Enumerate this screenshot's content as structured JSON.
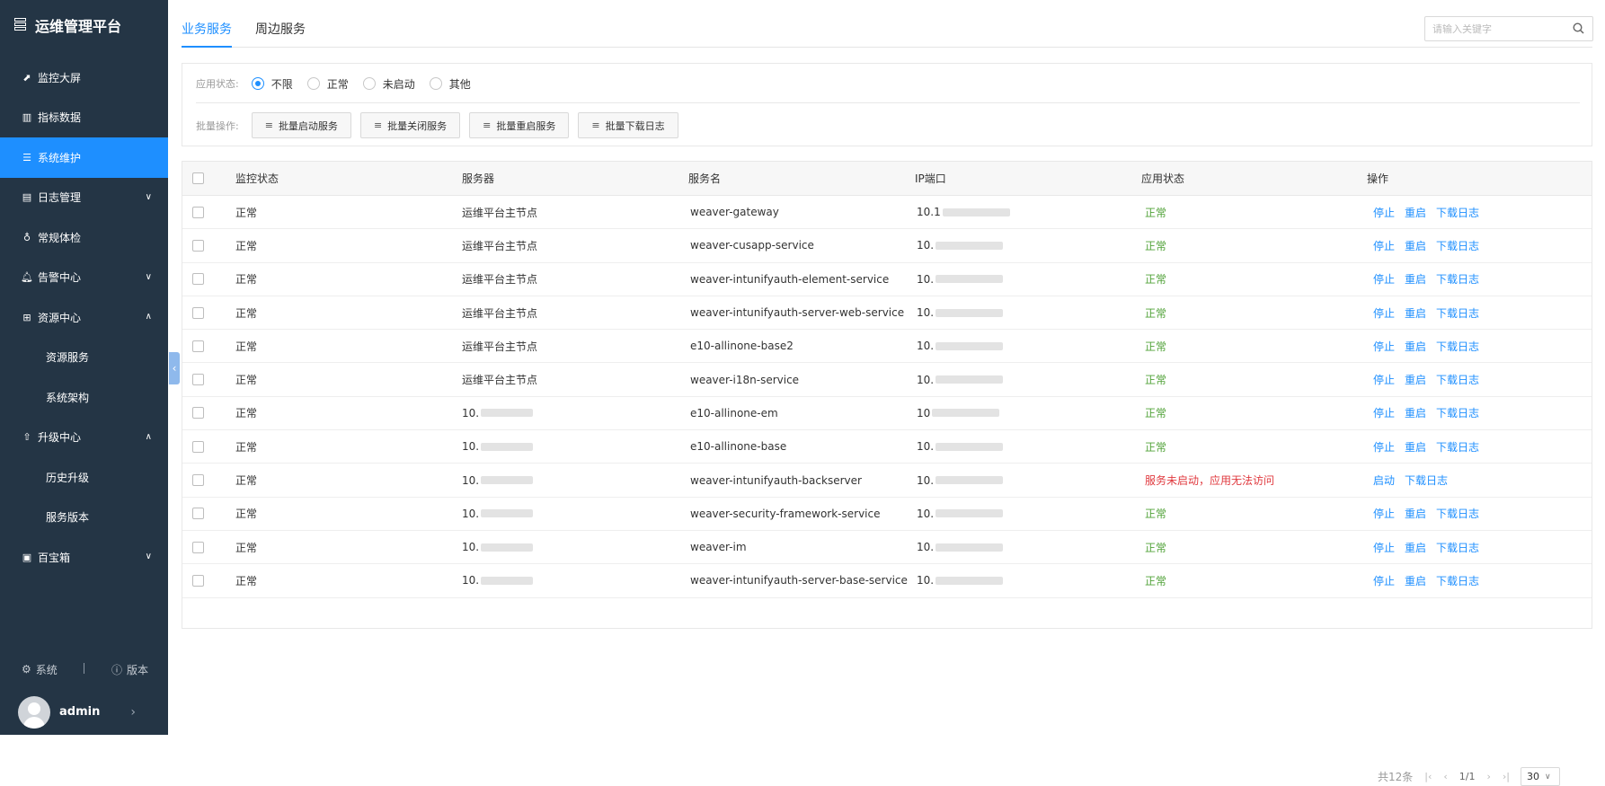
{
  "app": {
    "title": "运维管理平台"
  },
  "sidebar": {
    "items": [
      {
        "label": "监控大屏",
        "icon": "chart-line-icon"
      },
      {
        "label": "指标数据",
        "icon": "bar-chart-icon"
      },
      {
        "label": "系统维护",
        "icon": "sliders-icon",
        "active": true
      },
      {
        "label": "日志管理",
        "icon": "log-icon",
        "chevron": "chevron-down-icon"
      },
      {
        "label": "常规体检",
        "icon": "stethoscope-icon"
      },
      {
        "label": "告警中心",
        "icon": "bell-icon",
        "chevron": "chevron-down-icon"
      },
      {
        "label": "资源中心",
        "icon": "grid-icon",
        "chevron": "chevron-up-icon"
      },
      {
        "label": "资源服务",
        "sub": true
      },
      {
        "label": "系统架构",
        "sub": true
      },
      {
        "label": "升级中心",
        "icon": "upgrade-icon",
        "chevron": "chevron-up-icon"
      },
      {
        "label": "历史升级",
        "sub": true
      },
      {
        "label": "服务版本",
        "sub": true
      },
      {
        "label": "百宝箱",
        "icon": "toolbox-icon",
        "chevron": "chevron-down-icon"
      }
    ],
    "footer": {
      "system_label": "系统",
      "version_label": "版本"
    },
    "user": {
      "name": "admin"
    }
  },
  "tabs": [
    {
      "label": "业务服务",
      "active": true
    },
    {
      "label": "周边服务",
      "active": false
    }
  ],
  "search": {
    "placeholder": "请输入关键字"
  },
  "filters": {
    "status_label": "应用状态:",
    "options": [
      "不限",
      "正常",
      "未启动",
      "其他"
    ],
    "selected": "不限",
    "batch_label": "批量操作:",
    "buttons": [
      "批量启动服务",
      "批量关闭服务",
      "批量重启服务",
      "批量下载日志"
    ]
  },
  "table": {
    "columns": [
      "监控状态",
      "服务器",
      "服务名",
      "IP端口",
      "应用状态",
      "操作"
    ],
    "rows": [
      {
        "monitor": "正常",
        "server": "运维平台主节点",
        "service": "weaver-gateway",
        "ip": "10.1",
        "status": "正常",
        "state": "ok"
      },
      {
        "monitor": "正常",
        "server": "运维平台主节点",
        "service": "weaver-cusapp-service",
        "ip": "10.",
        "status": "正常",
        "state": "ok"
      },
      {
        "monitor": "正常",
        "server": "运维平台主节点",
        "service": "weaver-intunifyauth-element-service",
        "ip": "10.",
        "status": "正常",
        "state": "ok"
      },
      {
        "monitor": "正常",
        "server": "运维平台主节点",
        "service": "weaver-intunifyauth-server-web-service",
        "ip": "10.",
        "status": "正常",
        "state": "ok"
      },
      {
        "monitor": "正常",
        "server": "运维平台主节点",
        "service": "e10-allinone-base2",
        "ip": "10.",
        "status": "正常",
        "state": "ok"
      },
      {
        "monitor": "正常",
        "server": "运维平台主节点",
        "service": "weaver-i18n-service",
        "ip": "10.",
        "status": "正常",
        "state": "ok"
      },
      {
        "monitor": "正常",
        "server": "10.",
        "service": "e10-allinone-em",
        "ip": "10",
        "status": "正常",
        "state": "ok"
      },
      {
        "monitor": "正常",
        "server": "10.",
        "service": "e10-allinone-base",
        "ip": "10.",
        "status": "正常",
        "state": "ok"
      },
      {
        "monitor": "正常",
        "server": "10.",
        "service": "weaver-intunifyauth-backserver",
        "ip": "10.",
        "status": "服务未启动，应用无法访问",
        "state": "err"
      },
      {
        "monitor": "正常",
        "server": "10.",
        "service": "weaver-security-framework-service",
        "ip": "10.",
        "status": "正常",
        "state": "ok"
      },
      {
        "monitor": "正常",
        "server": "10.",
        "service": "weaver-im",
        "ip": "10.",
        "status": "正常",
        "state": "ok"
      },
      {
        "monitor": "正常",
        "server": "10.",
        "service": "weaver-intunifyauth-server-base-service",
        "ip": "10.",
        "status": "正常",
        "state": "ok"
      }
    ],
    "actions_running": [
      "停止",
      "重启",
      "下载日志"
    ],
    "actions_stopped": [
      "启动",
      "下载日志"
    ]
  },
  "pager": {
    "total": "共12条",
    "page": "1/1",
    "size": "30"
  },
  "colors": {
    "sidebar_bg": "#243545",
    "accent": "#1e8fff",
    "ok": "#52a33a",
    "error": "#e0393e"
  }
}
